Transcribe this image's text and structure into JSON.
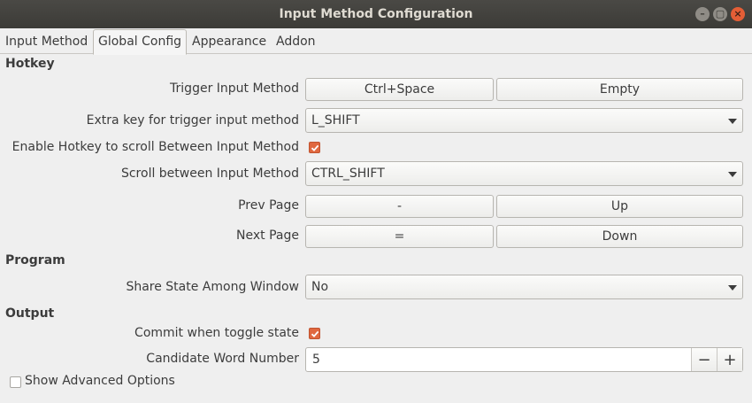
{
  "window": {
    "title": "Input Method Configuration",
    "controls": [
      "–",
      "▢",
      "×"
    ]
  },
  "tabs": [
    "Input Method",
    "Global Config",
    "Appearance",
    "Addon"
  ],
  "sections": {
    "hotkey": "Hotkey",
    "program": "Program",
    "output": "Output"
  },
  "hotkey": {
    "trigger_label": "Trigger Input Method",
    "trigger_key1": "Ctrl+Space",
    "trigger_key2": "Empty",
    "extra_label": "Extra key for trigger input method",
    "extra_value": "L_SHIFT",
    "enable_scroll_label": "Enable Hotkey to scroll Between Input Method",
    "enable_scroll_checked": true,
    "scroll_label": "Scroll between Input Method",
    "scroll_value": "CTRL_SHIFT",
    "prev_label": "Prev Page",
    "prev_key1": "-",
    "prev_key2": "Up",
    "next_label": "Next Page",
    "next_key1": "=",
    "next_key2": "Down"
  },
  "program": {
    "share_label": "Share State Among Window",
    "share_value": "No"
  },
  "output": {
    "commit_label": "Commit when toggle state",
    "commit_checked": true,
    "candidate_label": "Candidate Word Number",
    "candidate_value": "5",
    "minus": "−",
    "plus": "+"
  },
  "advanced": {
    "label": "Show Advanced Options",
    "checked": false
  }
}
